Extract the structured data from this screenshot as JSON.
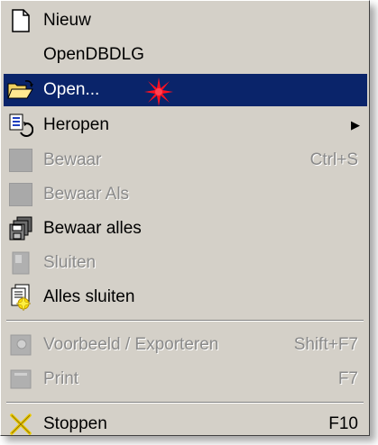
{
  "menu": {
    "items": [
      {
        "label": "Nieuw",
        "shortcut": "",
        "icon": "new-document-icon"
      },
      {
        "label": "OpenDBDLG",
        "shortcut": "",
        "icon": ""
      },
      {
        "label": "Open...",
        "shortcut": "",
        "icon": "open-folder-icon",
        "selected": true
      },
      {
        "label": "Heropen",
        "shortcut": "",
        "icon": "reopen-icon",
        "submenu": "▶"
      },
      {
        "label": "Bewaar",
        "shortcut": "Ctrl+S",
        "icon": "disabled-icon",
        "disabled": true
      },
      {
        "label": "Bewaar Als",
        "shortcut": "",
        "icon": "disabled-icon",
        "disabled": true
      },
      {
        "label": "Bewaar alles",
        "shortcut": "",
        "icon": "save-all-icon"
      },
      {
        "label": "Sluiten",
        "shortcut": "",
        "icon": "close-document-icon",
        "disabled": true
      },
      {
        "label": "Alles sluiten",
        "shortcut": "",
        "icon": "close-all-icon"
      },
      {
        "label": "Voorbeeld / Exporteren",
        "shortcut": "Shift+F7",
        "icon": "preview-icon",
        "disabled": true
      },
      {
        "label": "Print",
        "shortcut": "F7",
        "icon": "print-icon",
        "disabled": true
      },
      {
        "label": "Stoppen",
        "shortcut": "F10",
        "icon": "exit-x-icon"
      }
    ]
  },
  "colors": {
    "menu_bg": "#d4d0c8",
    "selection_bg": "#0a246a",
    "disabled_text": "#8a8a8a",
    "burst": "#ff1020"
  }
}
